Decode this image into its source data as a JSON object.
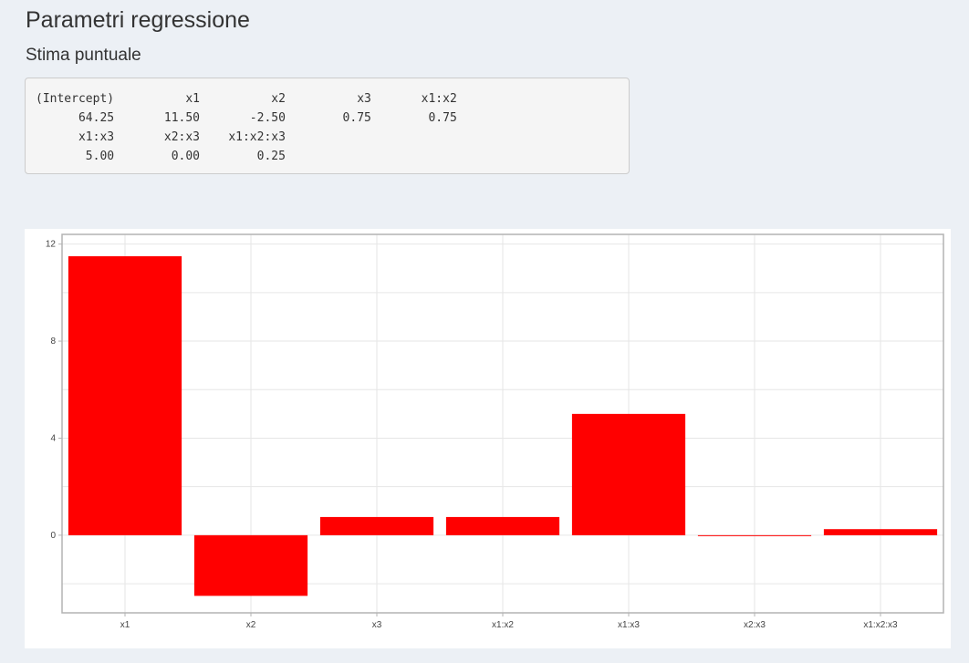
{
  "header": {
    "title": "Parametri regressione",
    "subtitle": "Stima puntuale"
  },
  "output": {
    "lines": [
      "(Intercept)          x1          x2          x3       x1:x2",
      "      64.25       11.50       -2.50        0.75        0.75",
      "      x1:x3       x2:x3    x1:x2:x3",
      "       5.00        0.00        0.25"
    ]
  },
  "chart_data": {
    "type": "bar",
    "categories": [
      "x1",
      "x2",
      "x3",
      "x1:x2",
      "x1:x3",
      "x2:x3",
      "x1:x2:x3"
    ],
    "values": [
      11.5,
      -2.5,
      0.75,
      0.75,
      5.0,
      0.0,
      0.25
    ],
    "title": "",
    "xlabel": "",
    "ylabel": "",
    "ylim": [
      -3.2,
      12.4
    ],
    "yticks": [
      0,
      4,
      8,
      12
    ],
    "bar_color": "#ff0000",
    "grid": true,
    "legend": "none"
  }
}
